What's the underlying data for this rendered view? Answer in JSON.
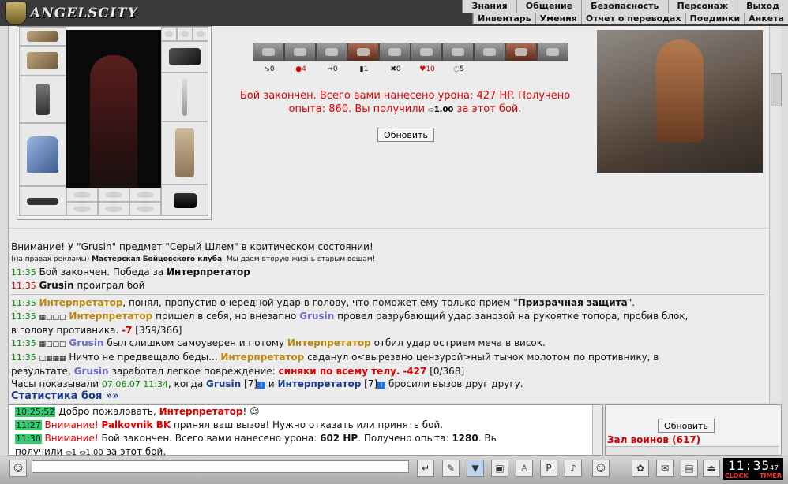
{
  "app": {
    "name": "ANGELSCITY"
  },
  "nav_top": [
    "Знания",
    "Общение",
    "Безопасность",
    "Персонаж",
    "Выход"
  ],
  "nav_sub": [
    "Инвентарь",
    "Умения",
    "Отчет о переводах",
    "Поединки",
    "Анкета"
  ],
  "stats_counts": [
    "0",
    "4",
    "0",
    "1",
    "0",
    "10",
    "5"
  ],
  "battle_result": {
    "line1": "Бой закончен. Всего вами нанесено урона: 427 HP. Получено",
    "line2": "опыта: 860. Вы получили",
    "money": "1.00",
    "line2_end": "за этот бой."
  },
  "refresh_label": "Обновить",
  "log": {
    "warning": "Внимание! У \"Grusin\" предмет \"Серый Шлем\" в критическом состоянии!",
    "ad_prefix": "(на правах рекламы)",
    "ad_bold": "Мастерская Бойцовского клуба",
    "ad_rest": ". Мы даем вторую жизнь старым вещам!",
    "l1_time": "11:35",
    "l1_text": "Бой закончен. Победа за",
    "l1_name": "Интерпретатор",
    "l2_time": "11:35",
    "l2_name": "Grusin",
    "l2_text": "проиграл бой",
    "l3_time": "11:35",
    "l3_name": "Интерпретатор",
    "l3_text": ", понял, пропустив очередной удар в голову, что поможет ему только прием \"",
    "l3_bold": "Призрачная защита",
    "l3_end": "\".",
    "l4_time": "11:35",
    "l4_name": "Интерпретатор",
    "l4_text": "пришел в себя, но внезапно",
    "l4_name2": "Grusin",
    "l4_text2": "провел разрубающий удар занозой на рукоятке топора, пробив блок,",
    "l4b_text": "в голову противника.",
    "l4b_dmg": "-7",
    "l4b_hp": "[359/366]",
    "l5_time": "11:35",
    "l5_name": "Grusin",
    "l5_text": "был слишком самоуверен и потому",
    "l5_name2": "Интерпретатор",
    "l5_text2": "отбил удар острием меча в висок.",
    "l6_time": "11:35",
    "l6_text": "Ничто не предвещало беды...",
    "l6_name": "Интерпретатор",
    "l6_text2": "саданул о<вырезано цензурой>ный тычок молотом по противнику, в",
    "l6b_text": "результате,",
    "l6b_name": "Grusin",
    "l6b_text2": "заработал легкое повреждение:",
    "l6b_dmg": "синяки по всему телу.",
    "l6b_dmg2": "-427",
    "l6b_hp": "[0/368]",
    "l7_text": "Часы показывали",
    "l7_date": "07.06.07 11:34",
    "l7_text2": ", когда",
    "l7_name": "Grusin",
    "l7_lvl": "[7]",
    "l7_and": "и",
    "l7_name2": "Интерпретатор",
    "l7_lvl2": "[7]",
    "l7_end": "бросили вызов друг другу."
  },
  "stat_link": "Статистика боя »»",
  "chat": {
    "c1_time": "10:25:52",
    "c1_text": "Добро пожаловать,",
    "c1_name": "Интерпретатор",
    "c1_end": "!",
    "c2_time": "11:27",
    "c2_warn": "Внимание!",
    "c2_name": "Palkovnik BK",
    "c2_text": "принял ваш вызов! Нужно отказать или принять бой.",
    "c3_time": "11:30",
    "c3_warn": "Внимание!",
    "c3_text": "Бой закончен. Всего вами нанесено урона:",
    "c3_dmg": "602 HP",
    "c3_text2": ". Получено опыта:",
    "c3_exp": "1280",
    "c3_text3": ". Вы",
    "c4_text": "получили",
    "c4_money": "1",
    "c4_money2": "1.00",
    "c4_end": "за этот бой."
  },
  "right_panel": {
    "refresh": "Обновить",
    "hall": "Зал воинов (617)"
  },
  "clock": {
    "time": "11:35",
    "sec": "47",
    "label1": "CLOCK",
    "label2": "TIMER"
  },
  "colors": {
    "accent_red": "#d00000",
    "name_gold": "#b8860b",
    "name_blue": "#6b6bc8"
  }
}
